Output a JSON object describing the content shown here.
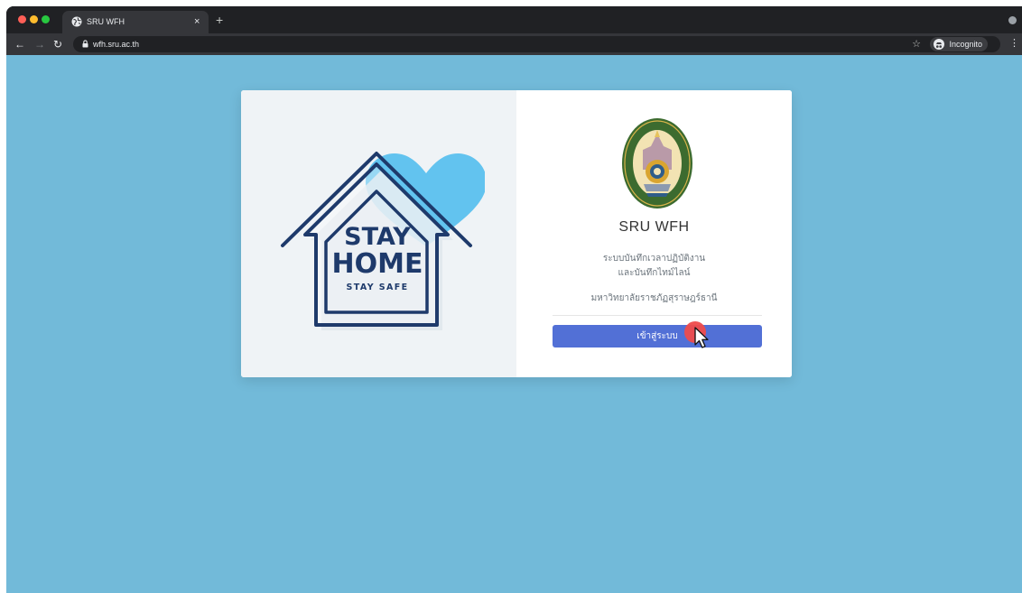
{
  "browser": {
    "tab_title": "SRU WFH",
    "tab_close": "×",
    "new_tab": "+",
    "url": "wfh.sru.ac.th",
    "incognito_label": "Incognito",
    "icons": [
      "back-icon",
      "forward-icon",
      "reload-icon",
      "lock-icon",
      "star-icon",
      "incognito-icon",
      "menu-icon"
    ]
  },
  "illustration": {
    "line1": "STAY",
    "line2": "HOME",
    "line3": "STAY SAFE"
  },
  "login": {
    "title": "SRU WFH",
    "subtitle_line1": "ระบบบันทึกเวลาปฏิบัติงาน",
    "subtitle_line2": "และบันทึกไทม์ไลน์",
    "university": "มหาวิทยาลัยราชภัฏสุราษฎร์ธานี",
    "button_label": "เข้าสู่ระบบ"
  },
  "colors": {
    "page_background": "#72bad9",
    "button": "#5270d6",
    "house": "#1e3a6b",
    "heart": "#62c3ef"
  }
}
